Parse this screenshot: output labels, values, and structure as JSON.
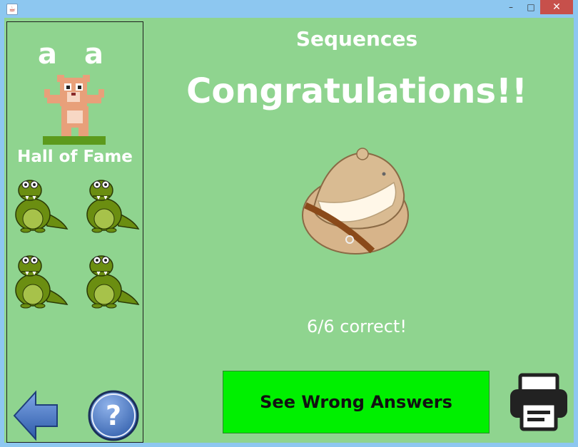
{
  "window": {
    "min_glyph": "–",
    "max_glyph": "□",
    "close_glyph": "✕"
  },
  "sidebar": {
    "user_letters": "a a",
    "hall_of_fame": "Hall of Fame"
  },
  "main": {
    "heading": "Sequences",
    "congrats": "Congratulations!!",
    "score": "6/6 correct!",
    "wrong_answers_label": "See Wrong Answers"
  },
  "colors": {
    "background": "#8fd48f",
    "button": "#00f000"
  }
}
